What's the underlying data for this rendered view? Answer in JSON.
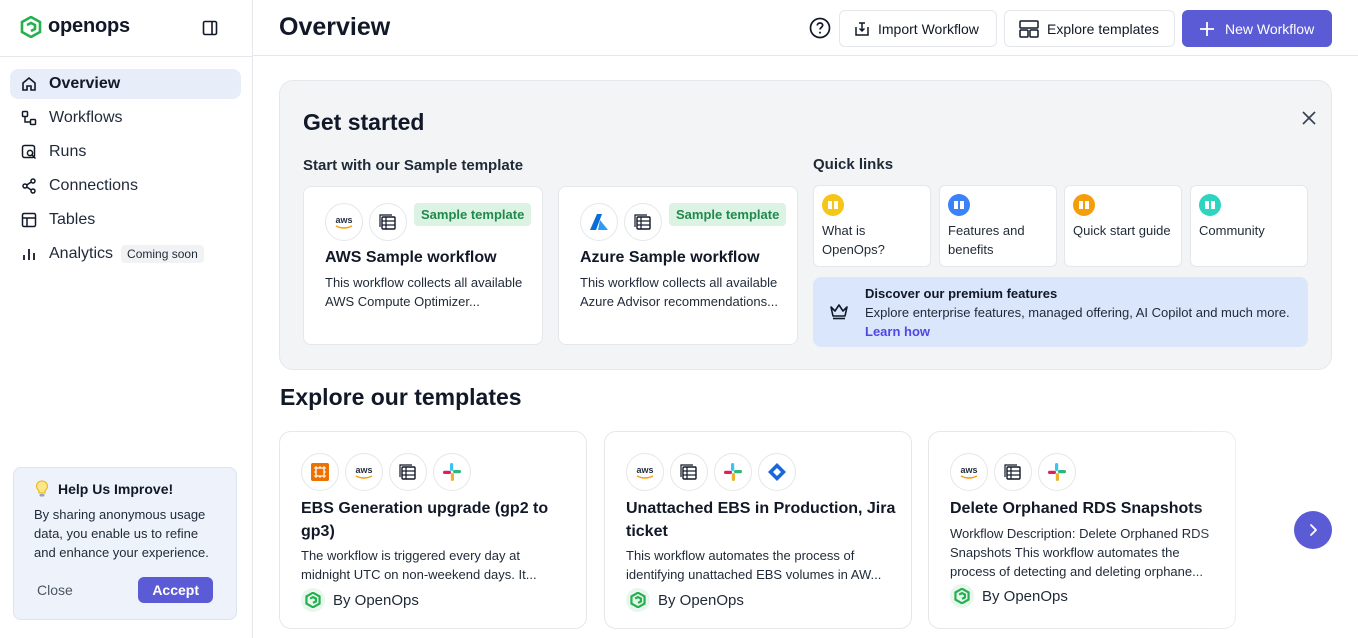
{
  "app": {
    "logo_text": "openops"
  },
  "sidebar": {
    "items": [
      {
        "label": "Overview",
        "icon": "home-icon"
      },
      {
        "label": "Workflows",
        "icon": "workflow-icon"
      },
      {
        "label": "Runs",
        "icon": "runs-icon"
      },
      {
        "label": "Connections",
        "icon": "share-icon"
      },
      {
        "label": "Tables",
        "icon": "table-icon"
      },
      {
        "label": "Analytics",
        "icon": "bar-chart-icon",
        "badge": "Coming soon"
      }
    ],
    "improve": {
      "title": "Help Us Improve!",
      "text": "By sharing anonymous usage data, you enable us to refine and enhance your experience.",
      "close_label": "Close",
      "accept_label": "Accept"
    }
  },
  "header": {
    "title": "Overview",
    "import_label": "Import Workflow",
    "explore_label": "Explore templates",
    "new_label": "New Workflow"
  },
  "get_started": {
    "title": "Get started",
    "sample_heading": "Start with our Sample template",
    "samples": [
      {
        "name": "AWS Sample workflow",
        "badge": "Sample template",
        "desc": "This workflow collects all available AWS Compute Optimizer..."
      },
      {
        "name": "Azure Sample workflow",
        "badge": "Sample template",
        "desc": "This workflow collects all available Azure Advisor recommendations..."
      }
    ],
    "quick_links_heading": "Quick links",
    "quick_links": [
      {
        "label": "What is OpenOps?",
        "color": "#f5c518"
      },
      {
        "label": "Features and benefits",
        "color": "#3b82f6"
      },
      {
        "label": "Quick start guide",
        "color": "#f59e0b"
      },
      {
        "label": "Community",
        "color": "#2dd4bf"
      }
    ],
    "premium": {
      "title": "Discover our premium features",
      "text": "Explore enterprise features, managed offering, AI Copilot and much more.",
      "link": "Learn how"
    }
  },
  "templates": {
    "title": "Explore our templates",
    "cards": [
      {
        "name": "EBS Generation upgrade (gp2 to gp3)",
        "desc": "The workflow is triggered every day at midnight UTC on non-weekend days. It...",
        "by": "By OpenOps"
      },
      {
        "name": "Unattached EBS in Production, Jira ticket",
        "desc": "This workflow automates the process of identifying unattached EBS volumes in AW...",
        "by": "By OpenOps"
      },
      {
        "name": "Delete Orphaned RDS Snapshots",
        "desc": "Workflow Description: Delete Orphaned RDS Snapshots This workflow automates the process of detecting and deleting orphane...",
        "by": "By OpenOps"
      }
    ]
  },
  "colors": {
    "accent": "#5b5bd6",
    "brand_green": "#22b14c"
  }
}
